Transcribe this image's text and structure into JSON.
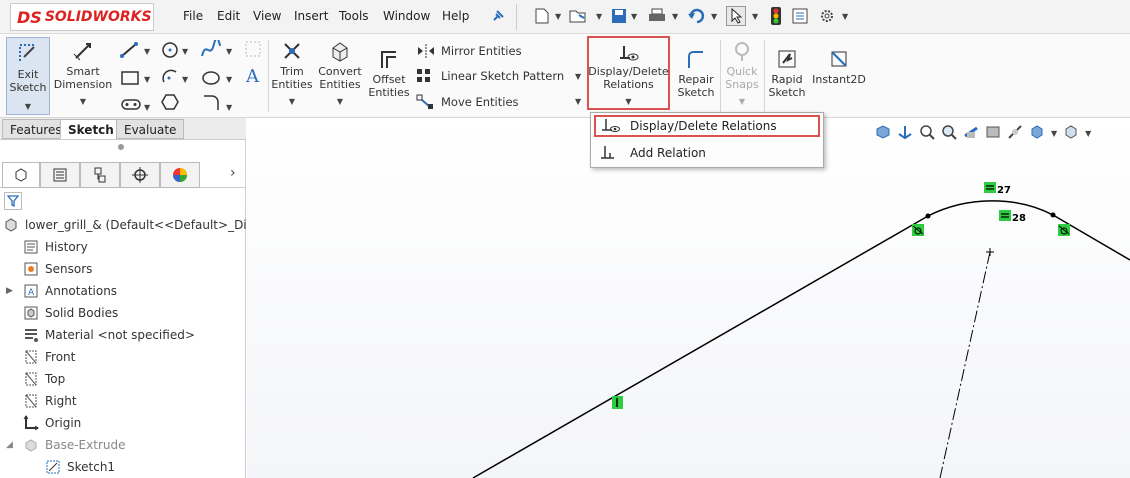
{
  "app": {
    "brand": "SOLIDWORKS",
    "brand_prefix": "DS"
  },
  "menu": [
    "File",
    "Edit",
    "View",
    "Insert",
    "Tools",
    "Window",
    "Help"
  ],
  "commands": {
    "exit_sketch": [
      "Exit",
      "Sketch"
    ],
    "smart_dimension": [
      "Smart",
      "Dimension"
    ],
    "trim_entities": [
      "Trim",
      "Entities"
    ],
    "convert_entities": [
      "Convert",
      "Entities"
    ],
    "offset_entities": [
      "Offset",
      "Entities"
    ],
    "mirror_entities": "Mirror Entities",
    "linear_sketch_pattern": "Linear Sketch Pattern",
    "move_entities": "Move Entities",
    "display_delete_relations": [
      "Display/Delete",
      "Relations"
    ],
    "repair_sketch": [
      "Repair",
      "Sketch"
    ],
    "quick_snaps": [
      "Quick",
      "Snaps"
    ],
    "rapid_sketch": [
      "Rapid",
      "Sketch"
    ],
    "instant2d": "Instant2D"
  },
  "tabs": [
    "Features",
    "Sketch",
    "Evaluate"
  ],
  "active_tab": "Sketch",
  "tree": {
    "root": "lower_grill_&  (Default<<Default>_Display",
    "items": [
      "History",
      "Sensors",
      "Annotations",
      "Solid Bodies",
      "Material <not specified>",
      "Front",
      "Top",
      "Right",
      "Origin",
      "Base-Extrude",
      "Sketch1"
    ]
  },
  "dropdown": {
    "items": [
      "Display/Delete Relations",
      "Add Relation"
    ]
  },
  "sketch": {
    "labels": [
      "27",
      "28"
    ]
  },
  "colors": {
    "accent_red": "#d9534f",
    "relation_green": "#2ecc40",
    "brand_red": "#dd2222"
  }
}
